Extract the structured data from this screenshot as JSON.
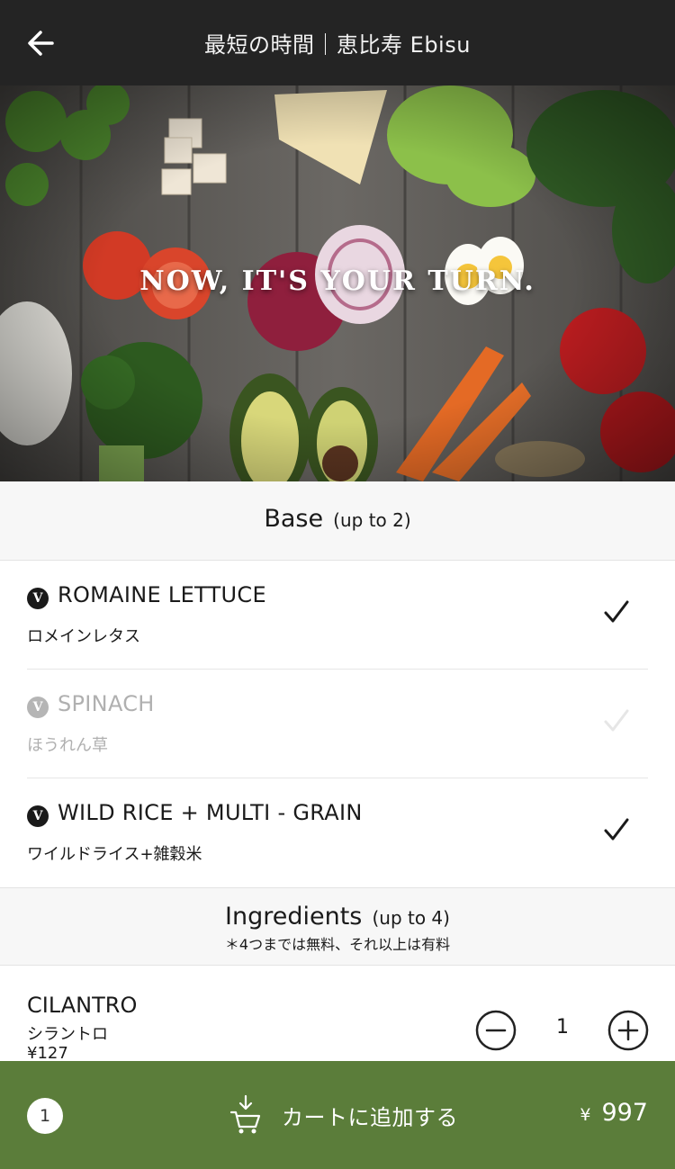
{
  "header": {
    "title": "最短の時間｜恵比寿 Ebisu"
  },
  "hero": {
    "tagline": "NOW, IT'S YOUR TURN."
  },
  "base_section": {
    "title": "Base",
    "limit": "(up to 2)",
    "items": [
      {
        "badge": "V",
        "name": "ROMAINE LETTUCE",
        "name_jp": "ロメインレタス",
        "selected": true
      },
      {
        "badge": "V",
        "name": "SPINACH",
        "name_jp": "ほうれん草",
        "selected": false
      },
      {
        "badge": "V",
        "name": "WILD RICE + MULTI - GRAIN",
        "name_jp": "ワイルドライス+雑穀米",
        "selected": true
      }
    ]
  },
  "ingredients_section": {
    "title": "Ingredients",
    "limit": "(up to 4)",
    "note": "＊4つまでは無料、それ以上は有料",
    "items": [
      {
        "name": "CILANTRO",
        "name_jp": "シラントロ",
        "price": "¥127",
        "quantity": "1"
      }
    ]
  },
  "cart": {
    "count": "1",
    "label": "カートに追加する",
    "currency": "¥",
    "total": "997"
  },
  "colors": {
    "header_bg": "#242424",
    "cart_bar_bg": "#5b7d3a",
    "disabled_text": "#b0b0b0"
  },
  "icons": {
    "back": "back-arrow-icon",
    "check": "checkmark-icon",
    "minus": "minus-circle-icon",
    "plus": "plus-circle-icon",
    "cart": "cart-download-icon"
  }
}
